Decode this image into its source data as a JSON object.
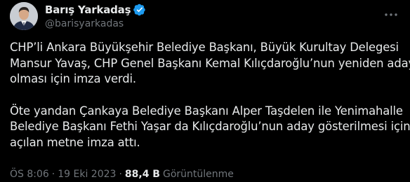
{
  "author": {
    "display_name": "Barış Yarkadaş",
    "handle": "@barisyarkadas",
    "avatar_icon": "user-avatar-icon",
    "verified_icon": "verified-badge-icon",
    "verified_color": "#1d9bf0"
  },
  "menu": {
    "icon": "more-options-icon"
  },
  "tweet": {
    "lines": [
      "CHP’li Ankara Büyükşehir Belediye Başkanı, Büyük Kurultay Delegesi",
      "Mansur Yavaş, CHP Genel Başkanı Kemal Kılıçdaroğlu’nun yeniden aday",
      "olması için imza verdi.",
      "Öte yandan Çankaya Belediye Başkanı Alper Taşdelen ile Yenimahalle",
      "Belediye Başkanı Fethi Yaşar da Kılıçdaroğlu’nun aday gösterilmesi için",
      "açılan metne imza attı."
    ]
  },
  "meta": {
    "time": "ÖS 8:06",
    "separator": "·",
    "date": "19 Eki 2023",
    "views_count": "88,4 B",
    "views_label": "Görüntülenme"
  },
  "colors": {
    "background": "#000000",
    "text_primary": "#e7e9ea",
    "text_secondary": "#71767b",
    "accent": "#1d9bf0"
  }
}
